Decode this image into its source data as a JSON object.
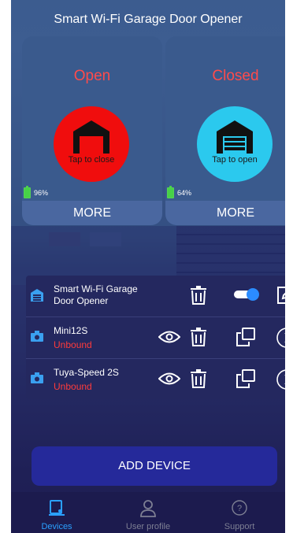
{
  "header": {
    "title": "Smart Wi-Fi Garage Door Opener"
  },
  "doors": [
    {
      "status": "Open",
      "hint": "Tap to close",
      "battery": "96%",
      "more": "MORE",
      "color": "#f00d0d"
    },
    {
      "status": "Closed",
      "hint": "Tap to open",
      "battery": "64%",
      "more": "MORE",
      "color": "#2bc9ee"
    }
  ],
  "devices": [
    {
      "name": "Smart Wi-Fi Garage Door Opener",
      "sub": "",
      "icon": "garage-device-icon",
      "toggle_on": true
    },
    {
      "name": "Mini12S",
      "sub": "Unbound",
      "icon": "camera-icon"
    },
    {
      "name": "Tuya-Speed 2S",
      "sub": "Unbound",
      "icon": "camera-icon"
    }
  ],
  "add_device": "ADD DEVICE",
  "tabs": [
    {
      "label": "Devices",
      "icon": "devices-icon",
      "active": true
    },
    {
      "label": "User profile",
      "icon": "user-icon",
      "active": false
    },
    {
      "label": "Support",
      "icon": "help-icon",
      "active": false
    }
  ],
  "colors": {
    "accent": "#2aa0ff",
    "unbound": "#ff3b3b",
    "battery": "#47d147"
  }
}
